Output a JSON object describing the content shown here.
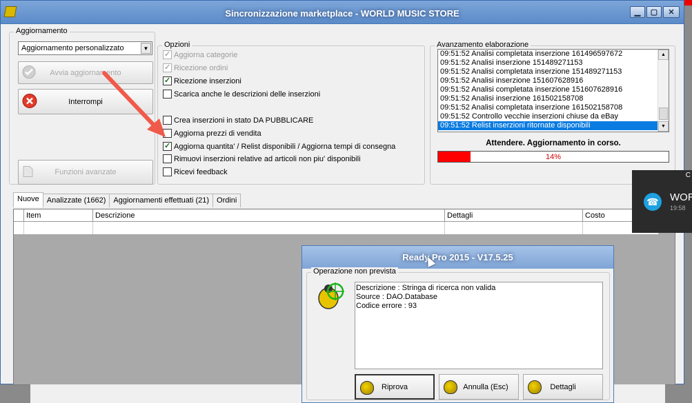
{
  "window": {
    "title": "Sincronizzazione marketplace - WORLD MUSIC STORE",
    "minimize": "▁",
    "maximize": "▢",
    "close": "✕"
  },
  "update_group": {
    "legend": "Aggiornamento",
    "mode_value": "Aggiornamento personalizzato",
    "start_button": "Avvia aggiornamento",
    "stop_button": "Interrompi",
    "advanced_button": "Funzioni avanzate"
  },
  "options_group": {
    "legend": "Opzioni",
    "items": [
      {
        "label": "Aggiorna categorie",
        "checked": true,
        "enabled": false
      },
      {
        "label": "Ricezione ordini",
        "checked": true,
        "enabled": false
      },
      {
        "label": "Ricezione inserzioni",
        "checked": true,
        "enabled": true
      },
      {
        "label": "Scarica anche le descrizioni delle inserzioni",
        "checked": false,
        "enabled": true
      },
      {
        "label": "Crea inserzioni in stato DA PUBBLICARE",
        "checked": false,
        "enabled": true
      },
      {
        "label": "Aggiorna prezzi di vendita",
        "checked": false,
        "enabled": true
      },
      {
        "label": "Aggiorna quantita' / Relist disponibili / Aggiorna tempi di consegna",
        "checked": true,
        "enabled": true
      },
      {
        "label": "Rimuovi inserzioni relative ad articoli non piu' disponibili",
        "checked": false,
        "enabled": true
      },
      {
        "label": "Ricevi feedback",
        "checked": false,
        "enabled": true
      }
    ]
  },
  "progress_group": {
    "legend": "Avanzamento elaborazione",
    "log": [
      "09:51:52 Analisi completata inserzione 161496597672",
      "09:51:52 Analisi inserzione 151489271153",
      "09:51:52 Analisi completata inserzione 151489271153",
      "09:51:52 Analisi inserzione 151607628916",
      "09:51:52 Analisi completata inserzione 151607628916",
      "09:51:52 Analisi inserzione 161502158708",
      "09:51:52 Analisi completata inserzione 161502158708",
      "09:51:52 Controllo vecchie inserzioni chiuse da eBay",
      "09:51:52 Relist inserzioni ritornate disponibili"
    ],
    "status": "Attendere. Aggiornamento in corso.",
    "percent_label": "14%",
    "percent": 14
  },
  "tabs": [
    "Nuove",
    "Analizzate (1662)",
    "Aggiornamenti effettuati (21)",
    "Ordini"
  ],
  "grid": {
    "columns": [
      "",
      "Item",
      "Descrizione",
      "Dettagli",
      "Costo"
    ]
  },
  "toast": {
    "top": "C",
    "title": "WOR",
    "time": "19:58"
  },
  "dialog": {
    "title": "Ready Pro 2015 - V17.5.25",
    "legend": "Operazione non prevista",
    "lines": [
      "Descrizione : Stringa di ricerca non valida",
      "Source : DAO.Database",
      "Codice errore : 93"
    ],
    "retry": "Riprova",
    "cancel": "Annulla (Esc)",
    "details": "Dettagli"
  },
  "colors": {
    "progress_fill": "#ff0000",
    "selection": "#0a7be0",
    "arrow": "#f05a4a"
  }
}
